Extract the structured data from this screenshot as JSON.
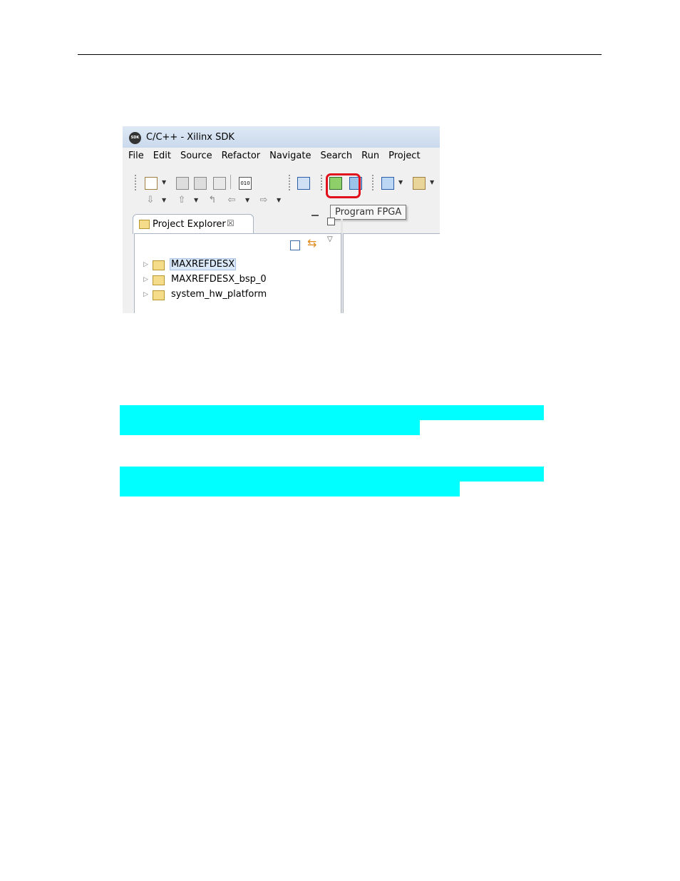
{
  "window": {
    "title": "C/C++ - Xilinx SDK",
    "logo_text": "SDK"
  },
  "menu": [
    "File",
    "Edit",
    "Source",
    "Refactor",
    "Navigate",
    "Search",
    "Run",
    "Project"
  ],
  "toolbar": {
    "bin_label": "010",
    "tooltip": "Program FPGA"
  },
  "project_explorer": {
    "tab_label": "Project Explorer",
    "close_glyph": "☒",
    "items": [
      {
        "label": "MAXREFDESX",
        "selected": true,
        "icon": "c-project-folder-icon"
      },
      {
        "label": "MAXREFDESX_bsp_0",
        "selected": false,
        "icon": "bsp-folder-icon"
      },
      {
        "label": "system_hw_platform",
        "selected": false,
        "icon": "hw-platform-folder-icon"
      }
    ]
  },
  "colors": {
    "highlight": "#00ffff",
    "callout": "#e0101c"
  }
}
